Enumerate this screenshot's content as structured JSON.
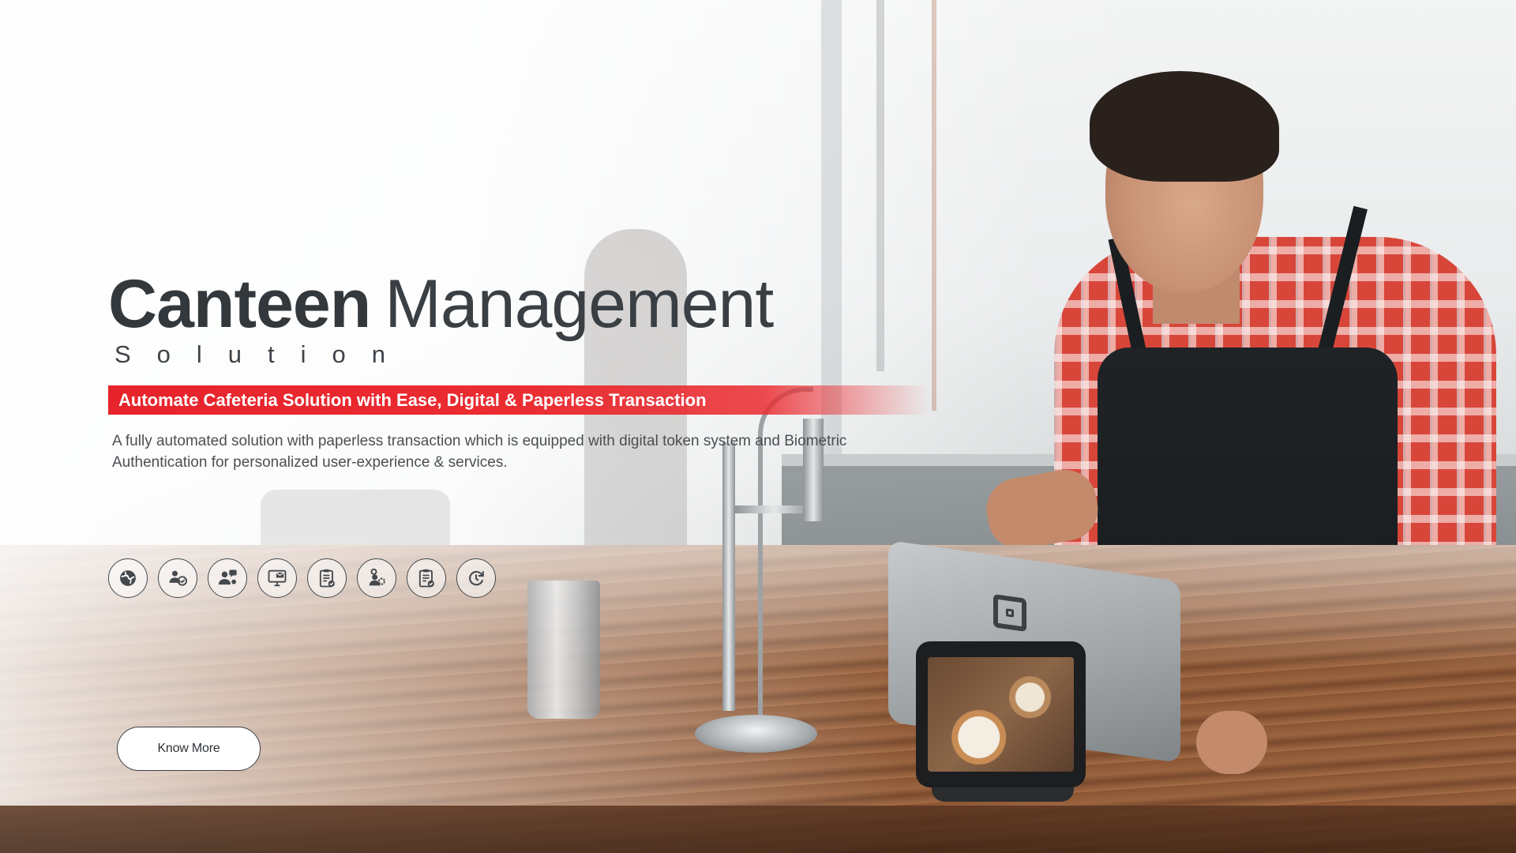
{
  "hero": {
    "title_strong": "Canteen",
    "title_light": "Management",
    "subtitle": "Solution",
    "tagline": "Automate Cafeteria Solution with Ease, Digital & Paperless Transaction",
    "description": "A fully automated solution with paperless transaction which is equipped with digital token system and Biometric Authentication for personalized user-experience & services.",
    "cta_label": "Know More"
  },
  "feature_icons": [
    "globe-icon",
    "user-sync-icon",
    "user-chat-icon",
    "monitor-mail-icon",
    "clipboard-check-icon",
    "user-settings-icon",
    "clipboard-check-icon",
    "refresh-arrow-icon"
  ],
  "colors": {
    "accent_red": "#e7232b",
    "title_dark": "#33383d",
    "text_gray": "#4b4f53"
  }
}
